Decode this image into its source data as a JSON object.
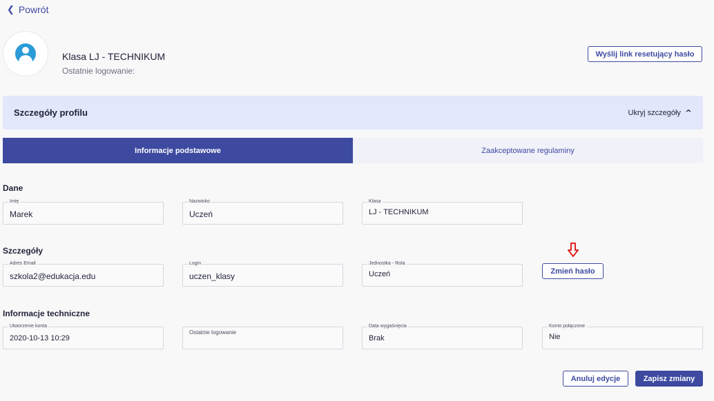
{
  "nav": {
    "back_label": "Powrót"
  },
  "profile": {
    "name": "Klasa LJ - TECHNIKUM",
    "last_login_label": "Ostatnie logowanie:",
    "reset_button": "Wyślij link resetujący hasło"
  },
  "details_section": {
    "title": "Szczegóły profilu",
    "toggle_label": "Ukryj szczegóły"
  },
  "tabs": [
    {
      "label": "Informacje podstawowe",
      "active": true
    },
    {
      "label": "Zaakceptowane regulaminy",
      "active": false
    }
  ],
  "groups": {
    "dane": {
      "title": "Dane",
      "fields": [
        {
          "label": "Imię",
          "value": "Marek"
        },
        {
          "label": "Nazwisko",
          "value": "Uczeń"
        },
        {
          "label": "Klasa",
          "value": "LJ - TECHNIKUM"
        }
      ]
    },
    "szczegoly": {
      "title": "Szczegóły",
      "fields": [
        {
          "label": "Adres Email",
          "value": "szkola2@edukacja.edu"
        },
        {
          "label": "Login",
          "value": "uczen_klasy"
        },
        {
          "label": "Jednostka - Rola",
          "value": "Uczeń"
        }
      ],
      "change_password_button": "Zmień hasło"
    },
    "techniczne": {
      "title": "Informacje techniczne",
      "fields": [
        {
          "label": "Utworzenie konta",
          "value": "2020-10-13 10:29"
        },
        {
          "label": "Ostatnie logowanie",
          "value": ""
        },
        {
          "label": "Data wygaśnięcia",
          "value": "Brak"
        },
        {
          "label": "Konto połączone",
          "value": "Nie"
        }
      ]
    }
  },
  "footer": {
    "cancel_button": "Anuluj edycje",
    "save_button": "Zapisz zmiany"
  },
  "colors": {
    "primary": "#3d4aa0",
    "section_bg": "#e3e7fb",
    "avatar": "#2b9bd8",
    "annotation_arrow": "#e02020"
  }
}
